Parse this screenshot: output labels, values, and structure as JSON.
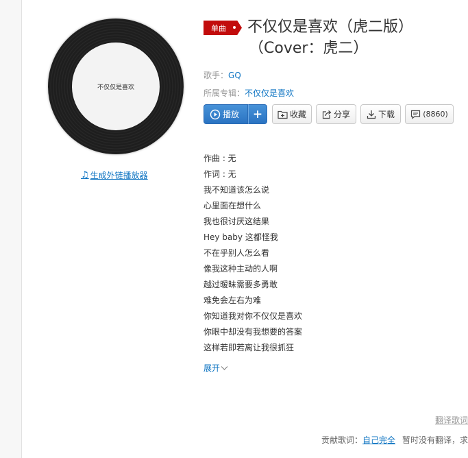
{
  "cover": {
    "label": "不仅仅是喜欢"
  },
  "ext_player": {
    "label": "生成外链播放器"
  },
  "song": {
    "badge": "单曲",
    "title_line1": "不仅仅是喜欢（虎二版）",
    "title_line2": "（Cover：虎二）",
    "singer_label": "歌手：",
    "singer": "GQ",
    "album_label": "所属专辑：",
    "album": "不仅仅是喜欢"
  },
  "actions": {
    "play": "播放",
    "add": "+",
    "collect": "收藏",
    "share": "分享",
    "download": "下载",
    "comment": "(8860)"
  },
  "lyrics": [
    "作曲 : 无",
    "作词 : 无",
    "我不知道该怎么说",
    "心里面在想什么",
    "我也很讨厌这结果",
    "Hey baby 这都怪我",
    "不在乎别人怎么看",
    "像我这种主动的人啊",
    "越过暧昧需要多勇敢",
    "难免会左右为难",
    "你知道我对你不仅仅是喜欢",
    "你眼中却没有我想要的答案",
    "这样若即若离让我很抓狂"
  ],
  "expand_label": "展开",
  "translate_label": "翻译歌词",
  "contrib": {
    "label": "贡献歌词：",
    "link": "自己完全",
    "note": "暂时没有翻译，求"
  },
  "colors": {
    "brand_red": "#c20c0c",
    "link_blue": "#0c73c2",
    "play_blue": "#2a73c2"
  }
}
